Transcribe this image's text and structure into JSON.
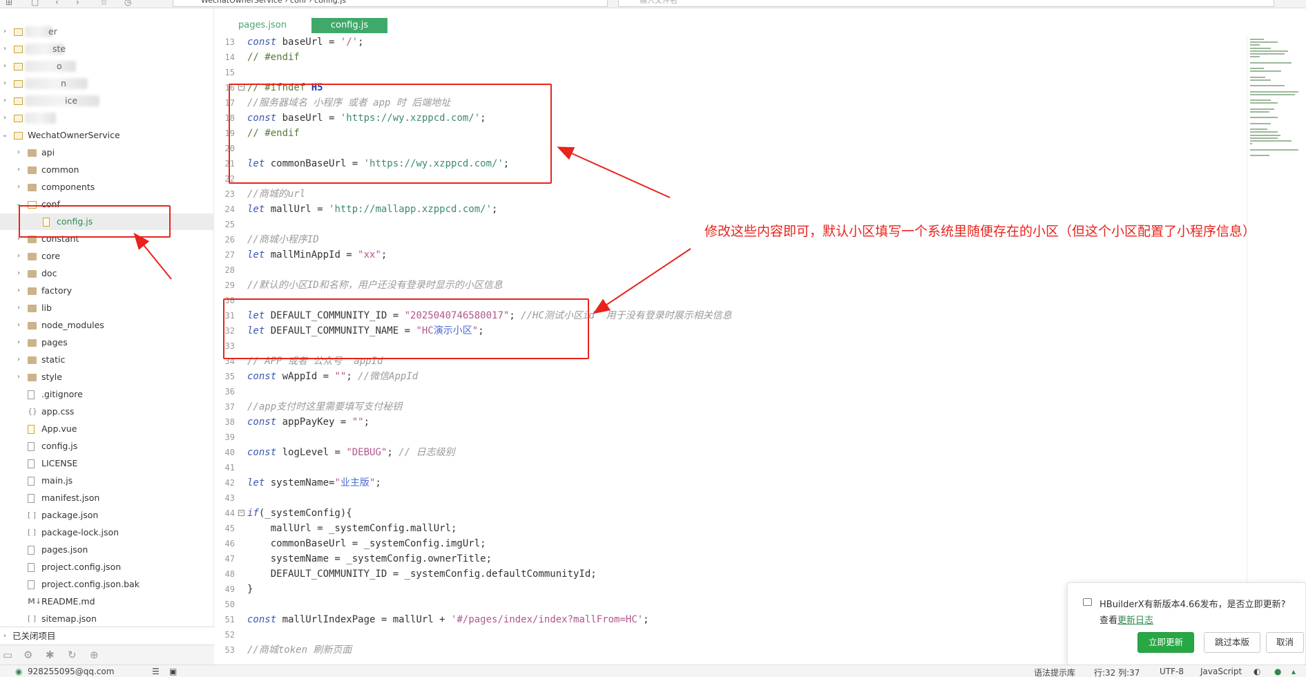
{
  "toolbar": {
    "address": "WechatOwnerService  ›  conf  ›  config.js",
    "find_placeholder": "输入文件名",
    "right_label": "预览"
  },
  "sidebar": {
    "blurred_projects": [
      "er",
      "ste",
      "o",
      "n",
      "ice",
      ""
    ],
    "project_name": "WechatOwnerService",
    "items": [
      {
        "label": "api",
        "type": "folder"
      },
      {
        "label": "common",
        "type": "folder"
      },
      {
        "label": "components",
        "type": "folder"
      },
      {
        "label": "conf",
        "type": "folder-open"
      },
      {
        "label": "config.js",
        "type": "js",
        "selected": true
      },
      {
        "label": "constant",
        "type": "folder"
      },
      {
        "label": "core",
        "type": "folder"
      },
      {
        "label": "doc",
        "type": "folder"
      },
      {
        "label": "factory",
        "type": "folder"
      },
      {
        "label": "lib",
        "type": "folder"
      },
      {
        "label": "node_modules",
        "type": "folder"
      },
      {
        "label": "pages",
        "type": "folder"
      },
      {
        "label": "static",
        "type": "folder"
      },
      {
        "label": "style",
        "type": "folder"
      },
      {
        "label": ".gitignore",
        "type": "file"
      },
      {
        "label": "app.css",
        "type": "css"
      },
      {
        "label": "App.vue",
        "type": "vue"
      },
      {
        "label": "config.js",
        "type": "file"
      },
      {
        "label": "LICENSE",
        "type": "file"
      },
      {
        "label": "main.js",
        "type": "file"
      },
      {
        "label": "manifest.json",
        "type": "file"
      },
      {
        "label": "package.json",
        "type": "json"
      },
      {
        "label": "package-lock.json",
        "type": "json"
      },
      {
        "label": "pages.json",
        "type": "file"
      },
      {
        "label": "project.config.json",
        "type": "file"
      },
      {
        "label": "project.config.json.bak",
        "type": "file"
      },
      {
        "label": "README.md",
        "type": "md"
      },
      {
        "label": "sitemap.json",
        "type": "json"
      }
    ],
    "closed_projects": "已关闭项目"
  },
  "tabs": [
    {
      "label": "pages.json",
      "active": false
    },
    {
      "label": "config.js",
      "active": true
    }
  ],
  "editor": {
    "lines": [
      {
        "n": "13",
        "code": "<span class=\"kw\">const</span> baseUrl = <span class=\"str\">'/'</span>;"
      },
      {
        "n": "14",
        "code": "<span class=\"dir\">// #endif</span>"
      },
      {
        "n": "15",
        "code": ""
      },
      {
        "n": "16",
        "code": "<span class=\"dir\">// #ifndef </span><span class=\"h5\">H5</span>",
        "fold": true
      },
      {
        "n": "17",
        "code": "<span class=\"cm\">//服务器域名 小程序 或者 app 时 后端地址</span>"
      },
      {
        "n": "18",
        "code": "<span class=\"kw\">const</span> baseUrl = <span class=\"str2\">'https://wy.xzppcd.com/'</span>;"
      },
      {
        "n": "19",
        "code": "<span class=\"dir\">// #endif</span>"
      },
      {
        "n": "20",
        "code": ""
      },
      {
        "n": "21",
        "code": "<span class=\"kw\">let</span> commonBaseUrl = <span class=\"str2\">'https://wy.xzppcd.com/'</span>;"
      },
      {
        "n": "22",
        "code": ""
      },
      {
        "n": "23",
        "code": "<span class=\"cm\">//商城的url</span>"
      },
      {
        "n": "24",
        "code": "<span class=\"kw\">let</span> mallUrl = <span class=\"str2\">'http://mallapp.xzppcd.com/'</span>;"
      },
      {
        "n": "25",
        "code": ""
      },
      {
        "n": "26",
        "code": "<span class=\"cm\">//商城小程序ID</span>"
      },
      {
        "n": "27",
        "code": "<span class=\"kw\">let</span> mallMinAppId = <span class=\"str\">\"xx\"</span>;"
      },
      {
        "n": "28",
        "code": ""
      },
      {
        "n": "29",
        "code": "<span class=\"cm\">//默认的小区ID和名称，用户还没有登录时显示的小区信息</span>"
      },
      {
        "n": "30",
        "code": ""
      },
      {
        "n": "31",
        "code": "<span class=\"kw\">let</span> DEFAULT_COMMUNITY_ID = <span class=\"str\">\"2025040746580017\"</span>; <span class=\"cm\">//HC测试小区id  用于没有登录时展示相关信息</span>"
      },
      {
        "n": "32",
        "code": "<span class=\"kw\">let</span> DEFAULT_COMMUNITY_NAME = <span class=\"str\">\"HC</span><span class=\"cn\">演示小区</span><span class=\"str\">\"</span>;"
      },
      {
        "n": "33",
        "code": ""
      },
      {
        "n": "34",
        "code": "<span class=\"cm\">// APP 或者 公众号  appId</span>"
      },
      {
        "n": "35",
        "code": "<span class=\"kw\">const</span> wAppId = <span class=\"str\">\"\"</span>; <span class=\"cm\">//微信AppId</span>"
      },
      {
        "n": "36",
        "code": ""
      },
      {
        "n": "37",
        "code": "<span class=\"cm\">//app支付时这里需要填写支付秘钥</span>"
      },
      {
        "n": "38",
        "code": "<span class=\"kw\">const</span> appPayKey = <span class=\"str\">\"\"</span>;"
      },
      {
        "n": "39",
        "code": ""
      },
      {
        "n": "40",
        "code": "<span class=\"kw\">const</span> logLevel = <span class=\"str\">\"DEBUG\"</span>; <span class=\"cm\">// 日志级别</span>"
      },
      {
        "n": "41",
        "code": ""
      },
      {
        "n": "42",
        "code": "<span class=\"kw\">let</span> systemName=<span class=\"str\">\"</span><span class=\"cn\">业主版</span><span class=\"str\">\"</span>;"
      },
      {
        "n": "43",
        "code": ""
      },
      {
        "n": "44",
        "code": "<span class=\"kw\">if</span>(_systemConfig){",
        "fold": true
      },
      {
        "n": "45",
        "code": "    mallUrl = _systemConfig.mallUrl;"
      },
      {
        "n": "46",
        "code": "    commonBaseUrl = _systemConfig.imgUrl;"
      },
      {
        "n": "47",
        "code": "    systemName = _systemConfig.ownerTitle;"
      },
      {
        "n": "48",
        "code": "    DEFAULT_COMMUNITY_ID = _systemConfig.defaultCommunityId;"
      },
      {
        "n": "49",
        "code": "}"
      },
      {
        "n": "50",
        "code": ""
      },
      {
        "n": "51",
        "code": "<span class=\"kw\">const</span> mallUrlIndexPage = mallUrl + <span class=\"str\">'#/pages/index/index?mallFrom=HC'</span>;"
      },
      {
        "n": "52",
        "code": ""
      },
      {
        "n": "53",
        "code": "<span class=\"cm\">//商城token 刷新页面</span>"
      }
    ]
  },
  "annotation": {
    "text": "修改这些内容即可，默认小区填写一个系统里随便存在的小区（但这个小区配置了小程序信息）",
    "color": "#e8231b"
  },
  "notification": {
    "message": "HBuilderX有新版本4.66发布，是否立即更新?",
    "view_prefix": "查看",
    "changelog_link": "更新日志",
    "update_button": "立即更新",
    "skip_button": "跳过本版",
    "cancel_button": "取消"
  },
  "statusbar": {
    "account": "928255095@qq.com",
    "hint": "语法提示库",
    "position": "行:32  列:37",
    "encoding": "UTF-8",
    "language": "JavaScript"
  },
  "colors": {
    "accent": "#3fa86b",
    "annotation": "#e8231b",
    "primary_button": "#28a745"
  }
}
